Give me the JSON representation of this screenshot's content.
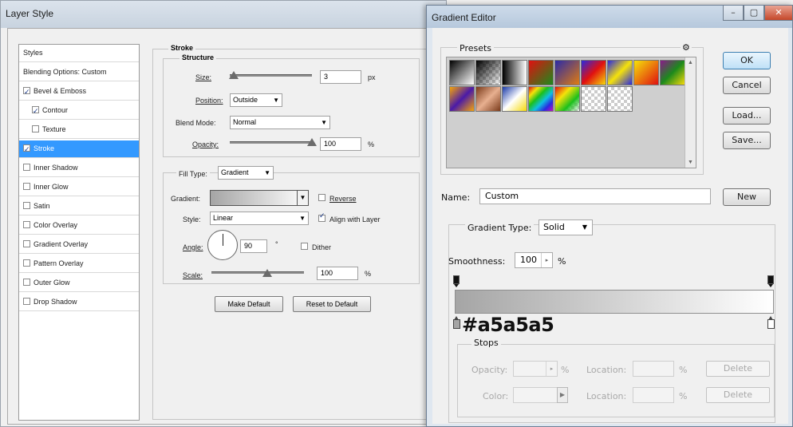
{
  "layer_style": {
    "title": "Layer Style",
    "styles_list": [
      {
        "label": "Styles",
        "checkbox": false,
        "checked": false,
        "sub": false,
        "selected": false
      },
      {
        "label": "Blending Options: Custom",
        "checkbox": false,
        "checked": false,
        "sub": false,
        "selected": false
      },
      {
        "label": "Bevel & Emboss",
        "checkbox": true,
        "checked": true,
        "sub": false,
        "selected": false
      },
      {
        "label": "Contour",
        "checkbox": true,
        "checked": true,
        "sub": true,
        "selected": false
      },
      {
        "label": "Texture",
        "checkbox": true,
        "checked": false,
        "sub": true,
        "selected": false
      },
      {
        "label": "Stroke",
        "checkbox": true,
        "checked": true,
        "sub": false,
        "selected": true
      },
      {
        "label": "Inner Shadow",
        "checkbox": true,
        "checked": false,
        "sub": false,
        "selected": false
      },
      {
        "label": "Inner Glow",
        "checkbox": true,
        "checked": false,
        "sub": false,
        "selected": false
      },
      {
        "label": "Satin",
        "checkbox": true,
        "checked": false,
        "sub": false,
        "selected": false
      },
      {
        "label": "Color Overlay",
        "checkbox": true,
        "checked": false,
        "sub": false,
        "selected": false
      },
      {
        "label": "Gradient Overlay",
        "checkbox": true,
        "checked": false,
        "sub": false,
        "selected": false
      },
      {
        "label": "Pattern Overlay",
        "checkbox": true,
        "checked": false,
        "sub": false,
        "selected": false
      },
      {
        "label": "Outer Glow",
        "checkbox": true,
        "checked": false,
        "sub": false,
        "selected": false
      },
      {
        "label": "Drop Shadow",
        "checkbox": true,
        "checked": false,
        "sub": false,
        "selected": false
      }
    ],
    "stroke": {
      "section_title": "Stroke",
      "structure_title": "Structure",
      "size_label": "Size:",
      "size_value": "3",
      "size_unit": "px",
      "position_label": "Position:",
      "position_value": "Outside",
      "blend_mode_label": "Blend Mode:",
      "blend_mode_value": "Normal",
      "opacity_label": "Opacity:",
      "opacity_value": "100",
      "opacity_unit": "%",
      "fill_type_label": "Fill Type:",
      "fill_type_value": "Gradient",
      "gradient_label": "Gradient:",
      "reverse_label": "Reverse",
      "style_label": "Style:",
      "style_value": "Linear",
      "align_label": "Align with Layer",
      "angle_label": "Angle:",
      "angle_value": "90",
      "angle_unit": "°",
      "dither_label": "Dither",
      "scale_label": "Scale:",
      "scale_value": "100",
      "scale_unit": "%",
      "make_default": "Make Default",
      "reset_default": "Reset to Default"
    }
  },
  "gradient_editor": {
    "title": "Gradient Editor",
    "presets_label": "Presets",
    "buttons": {
      "ok": "OK",
      "cancel": "Cancel",
      "load": "Load...",
      "save": "Save...",
      "new": "New"
    },
    "name_label": "Name:",
    "name_value": "Custom",
    "gradient_type_label": "Gradient Type:",
    "gradient_type_value": "Solid",
    "smoothness_label": "Smoothness:",
    "smoothness_value": "100",
    "smoothness_unit": "%",
    "annotation": "#a5a5a5",
    "stops": {
      "title": "Stops",
      "opacity_label": "Opacity:",
      "opacity_unit": "%",
      "location_label": "Location:",
      "location_unit": "%",
      "color_label": "Color:",
      "delete_label": "Delete"
    },
    "window_buttons": {
      "minimize": "–",
      "maximize": "▢",
      "close": "✕"
    }
  }
}
